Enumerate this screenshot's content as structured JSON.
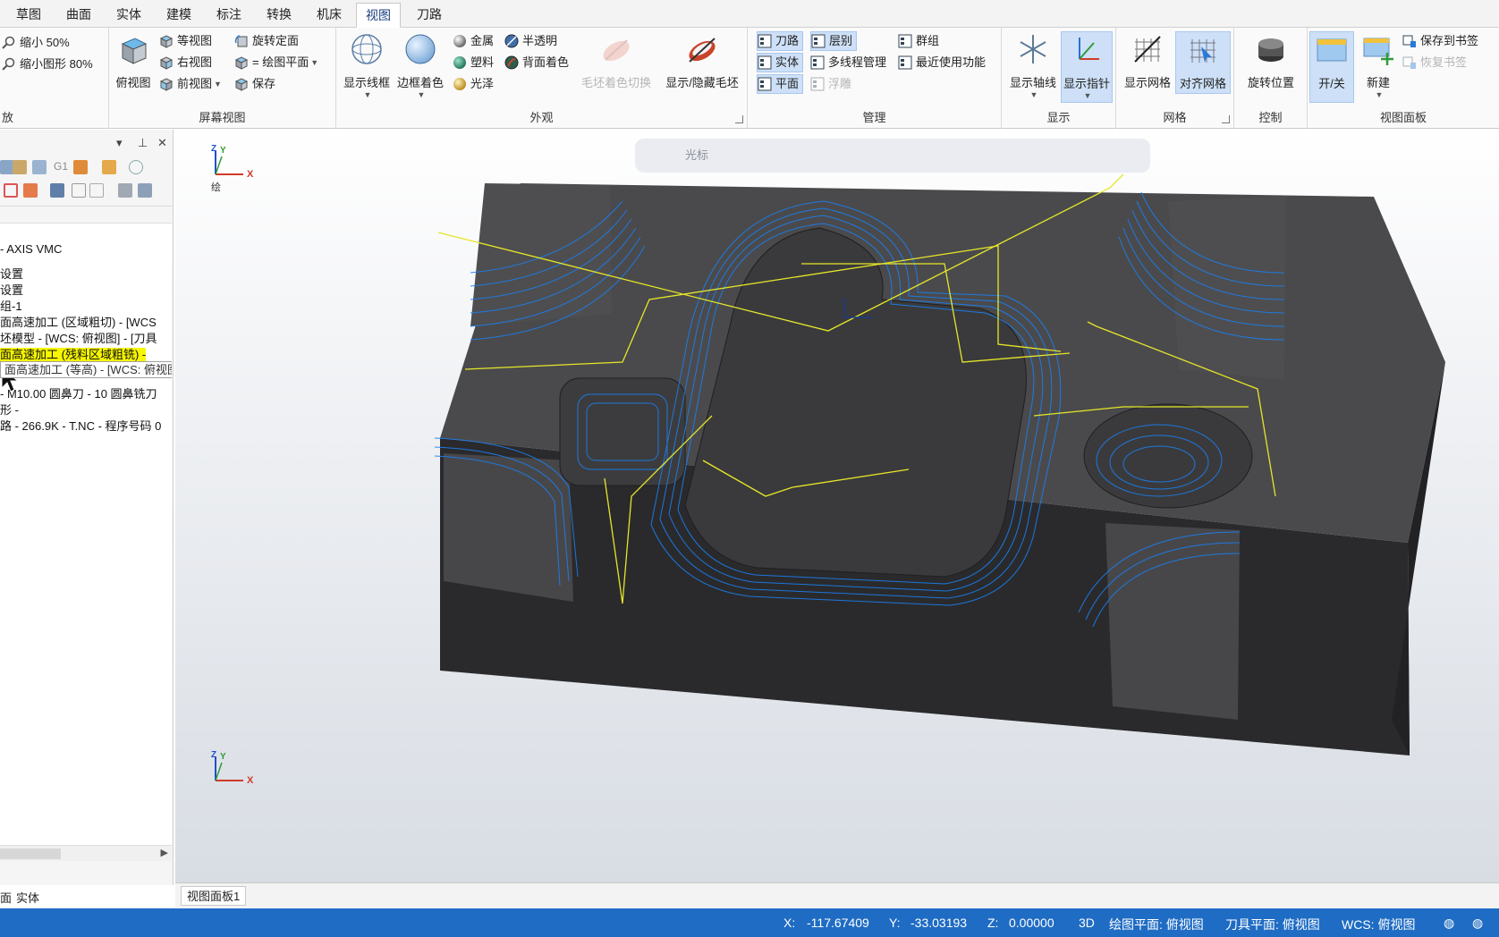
{
  "menu": {
    "tabs": [
      "草图",
      "曲面",
      "实体",
      "建模",
      "标注",
      "转换",
      "机床",
      "视图",
      "刀路"
    ],
    "active": "视图"
  },
  "ribbon": {
    "zoom": {
      "shrink_50": "缩小 50%",
      "shrink_80": "缩小图形 80%",
      "label": "放"
    },
    "screen_view": {
      "label": "屏幕视图",
      "top_view": "俯视图",
      "iso": "等视图",
      "right": "右视图",
      "front": "前视图",
      "rotate_plane": "旋转定面",
      "eq_cplane": "= 绘图平面",
      "save": "保存"
    },
    "appearance": {
      "label": "外观",
      "wireframe": "显示线框",
      "edge_shade": "边框着色",
      "metal": "金属",
      "plastic": "塑料",
      "gloss": "光泽",
      "translucent": "半透明",
      "back_shade": "背面着色",
      "stock_shade": "毛坯着色切换",
      "show_hide_stock": "显示/隐藏毛坯"
    },
    "manage": {
      "label": "管理",
      "toolpath": "刀路",
      "solid": "实体",
      "plane": "平面",
      "levels": "层别",
      "multithread": "多线程管理",
      "float": "浮雕",
      "group": "群组",
      "recent": "最近使用功能"
    },
    "display": {
      "label": "显示",
      "show_axes": "显示轴线",
      "show_gnomon": "显示指针"
    },
    "grid": {
      "label": "网格",
      "show_grid": "显示网格",
      "snap_grid": "对齐网格"
    },
    "control": {
      "label": "控制",
      "rotate_position": "旋转位置"
    },
    "viewsheet": {
      "label": "视图面板",
      "on_off": "开/关",
      "new": "新建",
      "save_bookmark": "保存到书签",
      "restore_bookmark": "恢复书签"
    }
  },
  "left_panel": {
    "tool_g1": "G1",
    "tree": [
      "- AXIS VMC",
      "设置",
      "设置",
      "组-1",
      "面高速加工 (区域粗切) - [WCS",
      "坯模型 - [WCS: 俯视图] - [刀具",
      "面高速加工 (残料区域粗铣) -",
      "- M10.00 圆鼻刀 - 10 圆鼻铣刀",
      "形 -",
      "路 - 266.9K - T.NC - 程序号码 0"
    ],
    "tooltip": "面高速加工 (等高) - [WCS: 俯视图] - [刀具面: 俯视图]",
    "bottom_tabs": [
      "面",
      "实体"
    ]
  },
  "viewport": {
    "floating_toolbar_label": "光标",
    "gnomon_top_label": "绘",
    "axis_labels": {
      "x": "X",
      "y": "Y",
      "z": "Z"
    },
    "tab": "视图面板1"
  },
  "status": {
    "x_label": "X:",
    "x": "-117.67409",
    "y_label": "Y:",
    "y": "-33.03193",
    "z_label": "Z:",
    "z": "0.00000",
    "mode": "3D",
    "cplane": "绘图平面: 俯视图",
    "tplane": "刀具平面: 俯视图",
    "wcs": "WCS: 俯视图"
  },
  "colors": {
    "toolpath": "#1a7ff0",
    "rapid": "#e6e62a",
    "part_top": "#4a4a4c",
    "part_side": "#2b2b2d",
    "status_bar": "#1f6cc4",
    "highlight": "#cde0f7"
  }
}
